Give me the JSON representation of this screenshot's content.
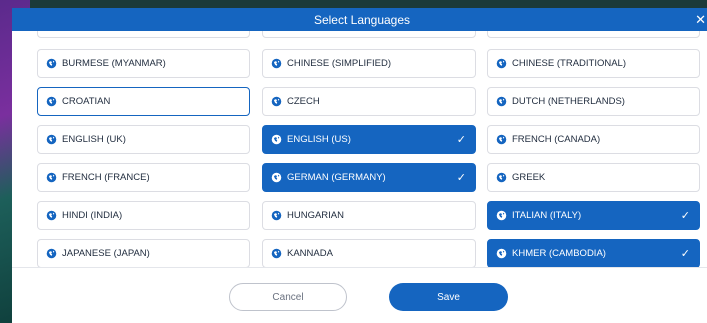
{
  "modal": {
    "title": "Select Languages",
    "close_glyph": "✕"
  },
  "languages": {
    "r0c0": {
      "label": "",
      "selected": false
    },
    "r0c1": {
      "label": "",
      "selected": false
    },
    "r0c2": {
      "label": "",
      "selected": false
    },
    "r1c0": {
      "label": "BURMESE (MYANMAR)",
      "selected": false
    },
    "r1c1": {
      "label": "CHINESE (SIMPLIFIED)",
      "selected": false
    },
    "r1c2": {
      "label": "CHINESE (TRADITIONAL)",
      "selected": false
    },
    "r2c0": {
      "label": "CROATIAN",
      "selected": false,
      "focused": true
    },
    "r2c1": {
      "label": "CZECH",
      "selected": false
    },
    "r2c2": {
      "label": "DUTCH (NETHERLANDS)",
      "selected": false
    },
    "r3c0": {
      "label": "ENGLISH (UK)",
      "selected": false
    },
    "r3c1": {
      "label": "ENGLISH (US)",
      "selected": true
    },
    "r3c2": {
      "label": "FRENCH (CANADA)",
      "selected": false
    },
    "r4c0": {
      "label": "FRENCH (FRANCE)",
      "selected": false
    },
    "r4c1": {
      "label": "GERMAN (GERMANY)",
      "selected": true
    },
    "r4c2": {
      "label": "GREEK",
      "selected": false
    },
    "r5c0": {
      "label": "HINDI (INDIA)",
      "selected": false
    },
    "r5c1": {
      "label": "HUNGARIAN",
      "selected": false
    },
    "r5c2": {
      "label": "ITALIAN (ITALY)",
      "selected": true
    },
    "r6c0": {
      "label": "JAPANESE (JAPAN)",
      "selected": false
    },
    "r6c1": {
      "label": "KANNADA",
      "selected": false
    },
    "r6c2": {
      "label": "KHMER (CAMBODIA)",
      "selected": true
    }
  },
  "icons": {
    "language": "globe-icon",
    "selected": "check-icon",
    "check_glyph": "✓"
  },
  "footer": {
    "cancel_label": "Cancel",
    "save_label": "Save"
  },
  "colors": {
    "accent": "#1565c0",
    "border": "#dcdde3",
    "text": "#1f2b3d"
  }
}
